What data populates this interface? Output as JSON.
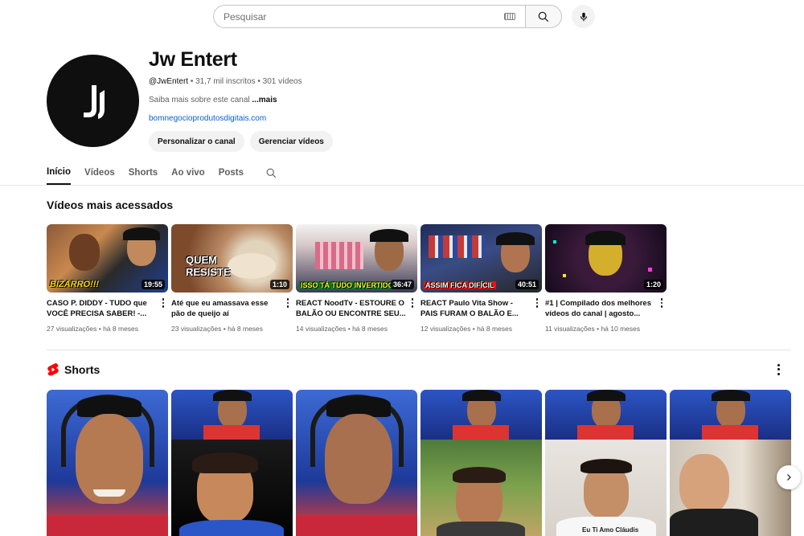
{
  "search": {
    "placeholder": "Pesquisar"
  },
  "channel": {
    "name": "Jw Entert",
    "handle": "@JwEntert",
    "subscribers": "31,7 mil inscritos",
    "video_count": "301 vídeos",
    "about": "Saiba mais sobre este canal",
    "about_more": "...mais",
    "link": "bomnegocioprodutosdigitais.com",
    "buttons": {
      "customize": "Personalizar o canal",
      "manage": "Gerenciar vídeos"
    }
  },
  "tabs": [
    "Início",
    "Vídeos",
    "Shorts",
    "Ao vivo",
    "Posts"
  ],
  "sections": {
    "popular_title": "Vídeos mais acessados",
    "shorts_title": "Shorts"
  },
  "videos": [
    {
      "title": "CASO P. DIDDY - TUDO que VOCÊ PRECISA SABER! -...",
      "views": "27 visualizações",
      "age": "há 8 meses",
      "duration": "19:55",
      "thumb_text": "BIZARRO!!!"
    },
    {
      "title": "Até que eu amassava esse pão de queijo aí",
      "views": "23 visualizações",
      "age": "há 8 meses",
      "duration": "1:10",
      "thumb_text": "QUEM RESISTE"
    },
    {
      "title": "REACT NoodTv - ESTOURE O BALÃO OU ENCONTRE SEU...",
      "views": "14 visualizações",
      "age": "há 8 meses",
      "duration": "36:47",
      "thumb_text": "ISSO TÁ TUDO INVERTIDO"
    },
    {
      "title": "REACT Paulo Vita Show - PAIS FURAM O BALÃO E...",
      "views": "12 visualizações",
      "age": "há 8 meses",
      "duration": "40:51",
      "thumb_text": "ASSIM FICA DIFÍCIL"
    },
    {
      "title": "#1 | Compilado dos melhores vídeos do canal | agosto...",
      "views": "11 visualizações",
      "age": "há 10 meses",
      "duration": "1:20",
      "thumb_text": ""
    }
  ],
  "colors": {
    "link": "#065fd4",
    "shorts_logo": "#ff0000",
    "text_secondary": "#606060"
  }
}
